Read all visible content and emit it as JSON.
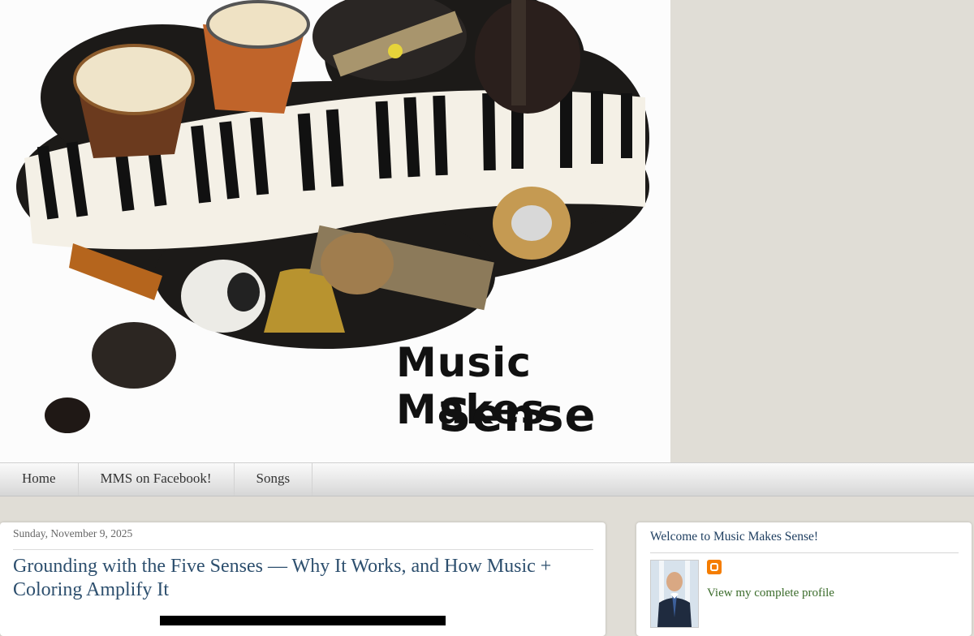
{
  "header": {
    "brand_line1": "Music Makes",
    "brand_line2": "Sense"
  },
  "nav": {
    "tabs": [
      {
        "label": "Home"
      },
      {
        "label": "MMS on Facebook!"
      },
      {
        "label": "Songs"
      }
    ]
  },
  "post": {
    "date": "Sunday, November 9, 2025",
    "title": "Grounding with the Five Senses — Why It Works, and How Music + Coloring Amplify It"
  },
  "sidebar": {
    "widget_title": "Welcome to Music Makes Sense!",
    "profile_link": "View my complete profile",
    "blogger_icon": "blogger-icon"
  },
  "colors": {
    "page_bg": "#e0ddd6",
    "title": "#2d4f6e",
    "link": "#3a6b2a",
    "blogger": "#f57d00"
  }
}
